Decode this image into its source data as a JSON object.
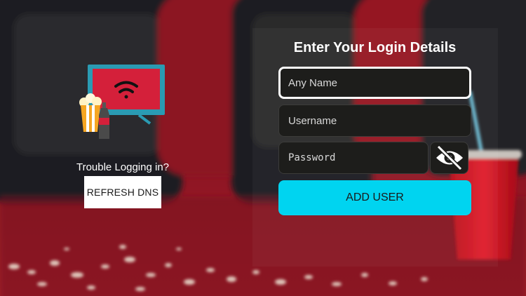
{
  "theme": {
    "accent": "#00d4f0",
    "screen_red": "#d4203a",
    "seat_red": "#8c1420",
    "carpet": "#a01828"
  },
  "left": {
    "logo_icons": [
      "tv-icon",
      "wifi-icon",
      "popcorn-icon",
      "soda-bottle-icon"
    ],
    "trouble_text": "Trouble Logging in?",
    "refresh_label": "REFRESH DNS"
  },
  "form": {
    "title": "Enter Your Login Details",
    "name_placeholder": "Any Name",
    "username_placeholder": "Username",
    "password_placeholder": "Password",
    "toggle_icon": "eye-slash-icon",
    "add_label": "ADD USER"
  }
}
